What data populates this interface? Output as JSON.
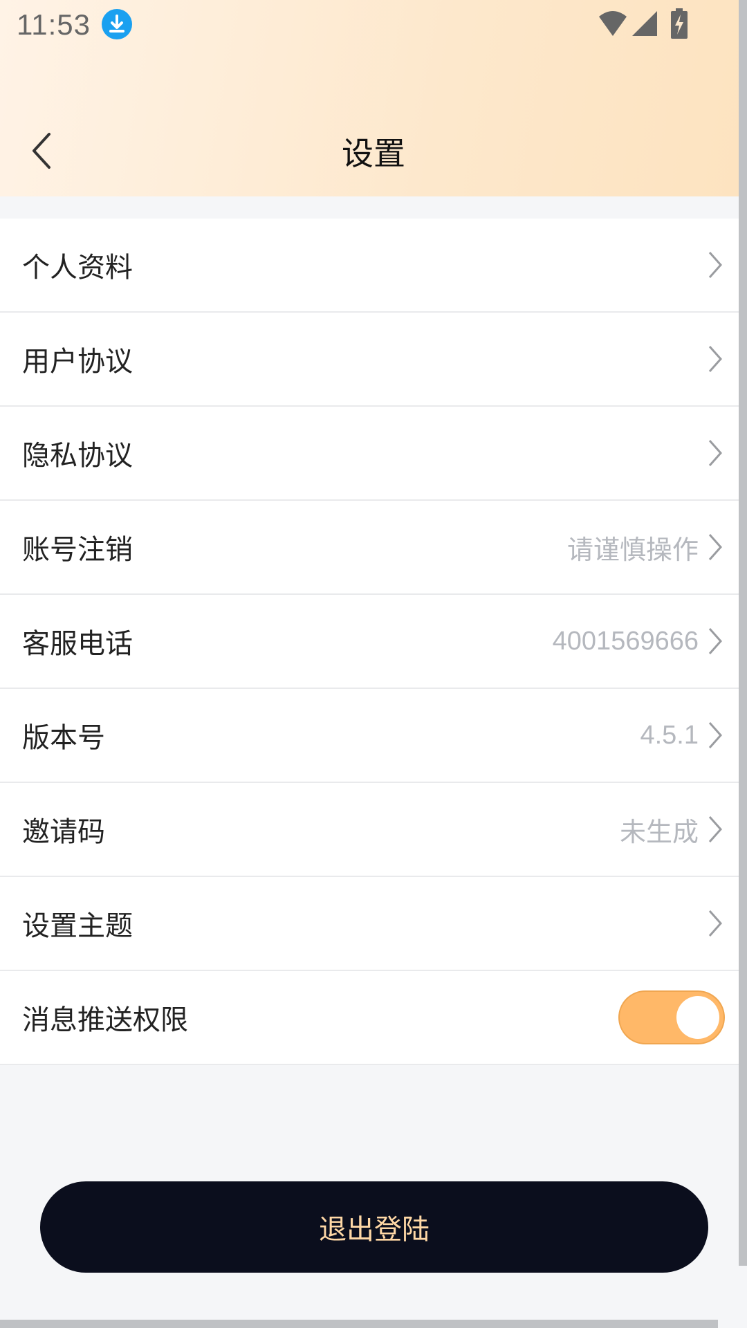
{
  "status_bar": {
    "time": "11:53",
    "icons": [
      "download-icon",
      "wifi-icon",
      "signal-icon",
      "battery-charging-icon"
    ]
  },
  "header": {
    "title": "设置",
    "back_icon": "chevron-left-icon"
  },
  "settings": {
    "items": [
      {
        "label": "个人资料",
        "value": ""
      },
      {
        "label": "用户协议",
        "value": ""
      },
      {
        "label": "隐私协议",
        "value": ""
      },
      {
        "label": "账号注销",
        "value": "请谨慎操作"
      },
      {
        "label": "客服电话",
        "value": "4001569666"
      },
      {
        "label": "版本号",
        "value": "4.5.1"
      },
      {
        "label": "邀请码",
        "value": "未生成"
      },
      {
        "label": "设置主题",
        "value": ""
      }
    ],
    "push": {
      "label": "消息推送权限",
      "enabled": true
    }
  },
  "logout": {
    "label": "退出登陆"
  },
  "colors": {
    "accent": "#ffb868",
    "button_bg": "#0b0e1d",
    "button_text": "#ffd8a6"
  }
}
